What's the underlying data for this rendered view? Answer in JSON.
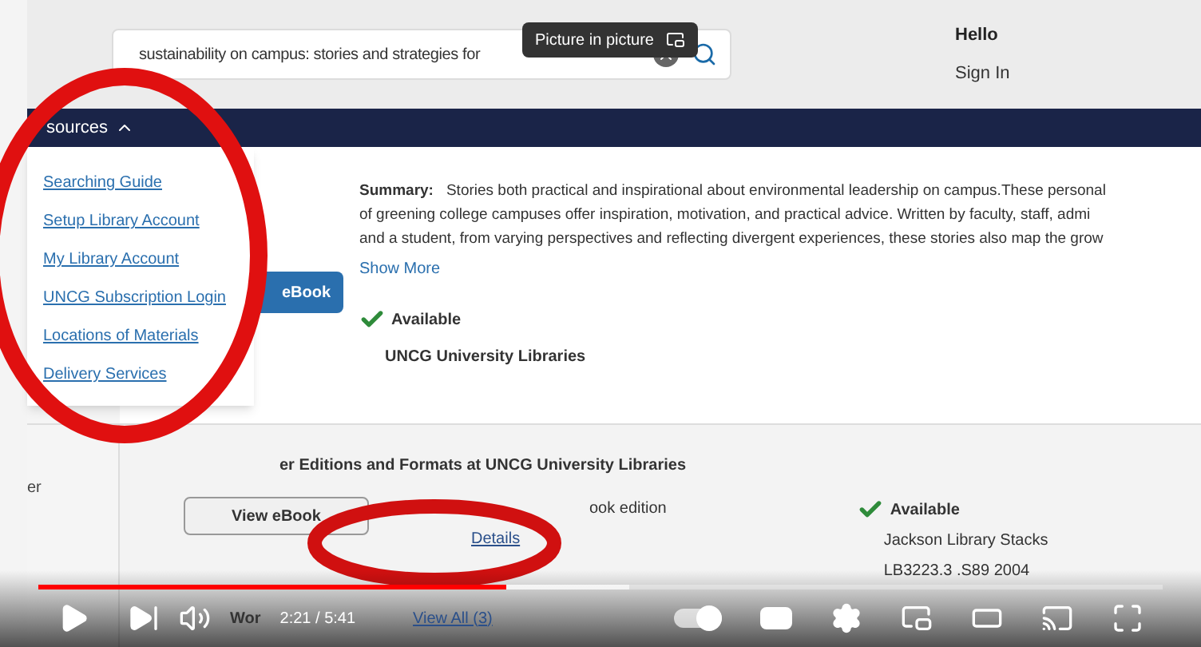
{
  "header": {
    "search_value": "sustainability on campus: stories and strategies for",
    "greeting": "Hello",
    "sign_in": "Sign In"
  },
  "tooltip": "Picture in picture",
  "nav": {
    "menu_label": "sources",
    "expanded": true
  },
  "menu_items": [
    "Searching Guide",
    "Setup Library Account",
    "My Library Account",
    "UNCG Subscription Login",
    "Locations of Materials",
    "Delivery Services"
  ],
  "record": {
    "summary_label": "Summary:",
    "summary_lines": [
      "Stories both practical and inspirational about environmental leadership on campus.These personal",
      "of greening college campuses offer inspiration, motivation, and practical advice. Written by faculty, staff, admi",
      "and a student, from varying perspectives and reflecting divergent experiences, these stories also map the grow"
    ],
    "show_more": "Show More",
    "button": "eBook",
    "availability": "Available",
    "library": "UNCG University Libraries"
  },
  "sidebar_fragment": "er",
  "editions": {
    "heading": "er Editions and Formats at UNCG University Libraries",
    "button": "View eBook",
    "edition": "ook edition",
    "details": "Details",
    "availability": "Available",
    "location": "Jackson Library Stacks",
    "call_number": "LB3223.3 .S89 2004"
  },
  "worldwide": {
    "heading": "Wor",
    "link": "View All (3)"
  },
  "player": {
    "time": "2:21 / 5:41",
    "played": {
      "level": 0.416
    },
    "buffered": {
      "level": 0.525
    },
    "autoplay_on": true
  }
}
